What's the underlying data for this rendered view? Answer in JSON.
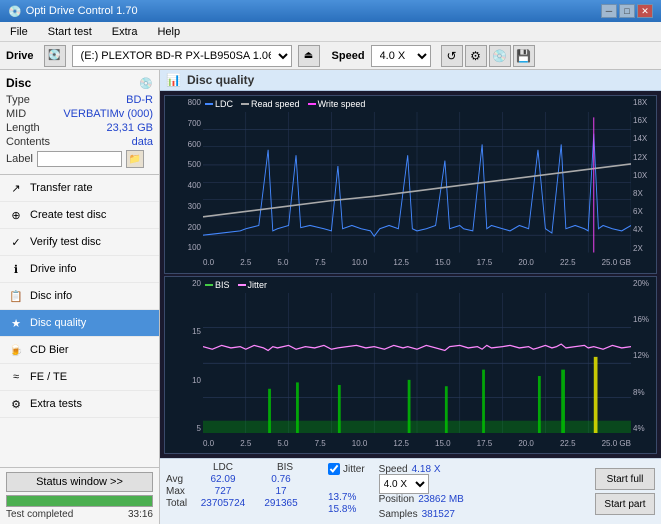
{
  "app": {
    "title": "Opti Drive Control 1.70",
    "title_icon": "💿"
  },
  "title_controls": {
    "minimize": "─",
    "maximize": "□",
    "close": "✕"
  },
  "menu": {
    "items": [
      "File",
      "Start test",
      "Extra",
      "Help"
    ]
  },
  "drive_bar": {
    "label": "Drive",
    "drive_value": "(E:)  PLEXTOR BD-R  PX-LB950SA 1.06",
    "speed_label": "Speed",
    "speed_value": "4.0 X"
  },
  "disc": {
    "title": "Disc",
    "type_label": "Type",
    "type_value": "BD-R",
    "mid_label": "MID",
    "mid_value": "VERBATIMv (000)",
    "length_label": "Length",
    "length_value": "23,31 GB",
    "contents_label": "Contents",
    "contents_value": "data",
    "label_label": "Label",
    "label_value": ""
  },
  "nav_items": [
    {
      "id": "transfer-rate",
      "label": "Transfer rate",
      "icon": "↗"
    },
    {
      "id": "create-test-disc",
      "label": "Create test disc",
      "icon": "⊕"
    },
    {
      "id": "verify-test-disc",
      "label": "Verify test disc",
      "icon": "✓"
    },
    {
      "id": "drive-info",
      "label": "Drive info",
      "icon": "ℹ"
    },
    {
      "id": "disc-info",
      "label": "Disc info",
      "icon": "📋"
    },
    {
      "id": "disc-quality",
      "label": "Disc quality",
      "icon": "★",
      "active": true
    },
    {
      "id": "cd-bier",
      "label": "CD Bier",
      "icon": "🍺"
    },
    {
      "id": "fe-te",
      "label": "FE / TE",
      "icon": "≈"
    },
    {
      "id": "extra-tests",
      "label": "Extra tests",
      "icon": "⚙"
    }
  ],
  "status": {
    "window_btn": "Status window >>",
    "progress": 100,
    "status_text": "Test completed",
    "time": "33:16"
  },
  "chart": {
    "title": "Disc quality",
    "top": {
      "legend": [
        {
          "label": "LDC",
          "color": "#4488ff"
        },
        {
          "label": "Read speed",
          "color": "#aaaaaa"
        },
        {
          "label": "Write speed",
          "color": "#ff44ff"
        }
      ],
      "y_left": [
        "800",
        "700",
        "600",
        "500",
        "400",
        "300",
        "200",
        "100"
      ],
      "y_right": [
        "18X",
        "16X",
        "14X",
        "12X",
        "10X",
        "8X",
        "6X",
        "4X",
        "2X"
      ],
      "x_labels": [
        "0.0",
        "2.5",
        "5.0",
        "7.5",
        "10.0",
        "12.5",
        "15.0",
        "17.5",
        "20.0",
        "22.5",
        "25.0 GB"
      ]
    },
    "bottom": {
      "legend": [
        {
          "label": "BIS",
          "color": "#44cc44"
        },
        {
          "label": "Jitter",
          "color": "#ff88ff"
        }
      ],
      "y_left": [
        "20",
        "15",
        "10",
        "5"
      ],
      "y_right": [
        "20%",
        "16%",
        "12%",
        "8%",
        "4%"
      ],
      "x_labels": [
        "0.0",
        "2.5",
        "5.0",
        "7.5",
        "10.0",
        "12.5",
        "15.0",
        "17.5",
        "20.0",
        "22.5",
        "25.0 GB"
      ]
    }
  },
  "stats": {
    "col1_header": "LDC",
    "col2_header": "BIS",
    "avg_label": "Avg",
    "avg_ldc": "62.09",
    "avg_bis": "0.76",
    "max_label": "Max",
    "max_ldc": "727",
    "max_bis": "17",
    "total_label": "Total",
    "total_ldc": "23705724",
    "total_bis": "291365",
    "jitter_checked": true,
    "jitter_label": "Jitter",
    "avg_jitter": "13.7%",
    "max_jitter": "15.8%",
    "speed_label": "Speed",
    "speed_value": "4.18 X",
    "speed_select": "4.0 X",
    "position_label": "Position",
    "position_value": "23862 MB",
    "samples_label": "Samples",
    "samples_value": "381527",
    "btn_start_full": "Start full",
    "btn_start_part": "Start part"
  }
}
